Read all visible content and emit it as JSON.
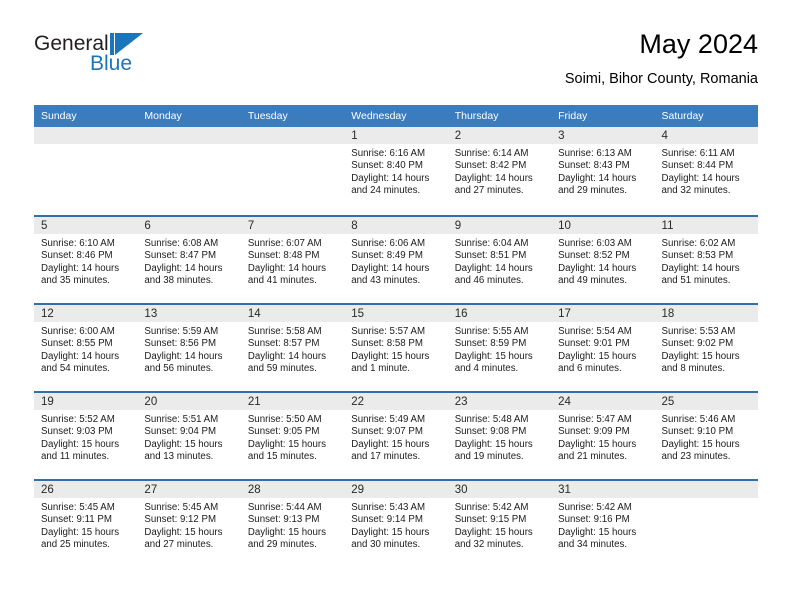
{
  "brand": {
    "name_top": "General",
    "name_bottom": "Blue",
    "mark": "triangle-logo",
    "accent_color": "#1b75bb"
  },
  "header": {
    "title": "May 2024",
    "subtitle": "Soimi, Bihor County, Romania"
  },
  "theme": {
    "header_blue": "#3b7cbe",
    "row_divider_blue": "#2f6fae",
    "day_band_gray": "#ebebeb"
  },
  "calendar": {
    "weekday_headers": [
      "Sunday",
      "Monday",
      "Tuesday",
      "Wednesday",
      "Thursday",
      "Friday",
      "Saturday"
    ],
    "labels": {
      "sunrise": "Sunrise:",
      "sunset": "Sunset:",
      "daylight": "Daylight:"
    },
    "weeks": [
      [
        {
          "day": "",
          "lines": []
        },
        {
          "day": "",
          "lines": []
        },
        {
          "day": "",
          "lines": []
        },
        {
          "day": "1",
          "lines": [
            "Sunrise: 6:16 AM",
            "Sunset: 8:40 PM",
            "Daylight: 14 hours and 24 minutes."
          ]
        },
        {
          "day": "2",
          "lines": [
            "Sunrise: 6:14 AM",
            "Sunset: 8:42 PM",
            "Daylight: 14 hours and 27 minutes."
          ]
        },
        {
          "day": "3",
          "lines": [
            "Sunrise: 6:13 AM",
            "Sunset: 8:43 PM",
            "Daylight: 14 hours and 29 minutes."
          ]
        },
        {
          "day": "4",
          "lines": [
            "Sunrise: 6:11 AM",
            "Sunset: 8:44 PM",
            "Daylight: 14 hours and 32 minutes."
          ]
        }
      ],
      [
        {
          "day": "5",
          "lines": [
            "Sunrise: 6:10 AM",
            "Sunset: 8:46 PM",
            "Daylight: 14 hours and 35 minutes."
          ]
        },
        {
          "day": "6",
          "lines": [
            "Sunrise: 6:08 AM",
            "Sunset: 8:47 PM",
            "Daylight: 14 hours and 38 minutes."
          ]
        },
        {
          "day": "7",
          "lines": [
            "Sunrise: 6:07 AM",
            "Sunset: 8:48 PM",
            "Daylight: 14 hours and 41 minutes."
          ]
        },
        {
          "day": "8",
          "lines": [
            "Sunrise: 6:06 AM",
            "Sunset: 8:49 PM",
            "Daylight: 14 hours and 43 minutes."
          ]
        },
        {
          "day": "9",
          "lines": [
            "Sunrise: 6:04 AM",
            "Sunset: 8:51 PM",
            "Daylight: 14 hours and 46 minutes."
          ]
        },
        {
          "day": "10",
          "lines": [
            "Sunrise: 6:03 AM",
            "Sunset: 8:52 PM",
            "Daylight: 14 hours and 49 minutes."
          ]
        },
        {
          "day": "11",
          "lines": [
            "Sunrise: 6:02 AM",
            "Sunset: 8:53 PM",
            "Daylight: 14 hours and 51 minutes."
          ]
        }
      ],
      [
        {
          "day": "12",
          "lines": [
            "Sunrise: 6:00 AM",
            "Sunset: 8:55 PM",
            "Daylight: 14 hours and 54 minutes."
          ]
        },
        {
          "day": "13",
          "lines": [
            "Sunrise: 5:59 AM",
            "Sunset: 8:56 PM",
            "Daylight: 14 hours and 56 minutes."
          ]
        },
        {
          "day": "14",
          "lines": [
            "Sunrise: 5:58 AM",
            "Sunset: 8:57 PM",
            "Daylight: 14 hours and 59 minutes."
          ]
        },
        {
          "day": "15",
          "lines": [
            "Sunrise: 5:57 AM",
            "Sunset: 8:58 PM",
            "Daylight: 15 hours and 1 minute."
          ]
        },
        {
          "day": "16",
          "lines": [
            "Sunrise: 5:55 AM",
            "Sunset: 8:59 PM",
            "Daylight: 15 hours and 4 minutes."
          ]
        },
        {
          "day": "17",
          "lines": [
            "Sunrise: 5:54 AM",
            "Sunset: 9:01 PM",
            "Daylight: 15 hours and 6 minutes."
          ]
        },
        {
          "day": "18",
          "lines": [
            "Sunrise: 5:53 AM",
            "Sunset: 9:02 PM",
            "Daylight: 15 hours and 8 minutes."
          ]
        }
      ],
      [
        {
          "day": "19",
          "lines": [
            "Sunrise: 5:52 AM",
            "Sunset: 9:03 PM",
            "Daylight: 15 hours and 11 minutes."
          ]
        },
        {
          "day": "20",
          "lines": [
            "Sunrise: 5:51 AM",
            "Sunset: 9:04 PM",
            "Daylight: 15 hours and 13 minutes."
          ]
        },
        {
          "day": "21",
          "lines": [
            "Sunrise: 5:50 AM",
            "Sunset: 9:05 PM",
            "Daylight: 15 hours and 15 minutes."
          ]
        },
        {
          "day": "22",
          "lines": [
            "Sunrise: 5:49 AM",
            "Sunset: 9:07 PM",
            "Daylight: 15 hours and 17 minutes."
          ]
        },
        {
          "day": "23",
          "lines": [
            "Sunrise: 5:48 AM",
            "Sunset: 9:08 PM",
            "Daylight: 15 hours and 19 minutes."
          ]
        },
        {
          "day": "24",
          "lines": [
            "Sunrise: 5:47 AM",
            "Sunset: 9:09 PM",
            "Daylight: 15 hours and 21 minutes."
          ]
        },
        {
          "day": "25",
          "lines": [
            "Sunrise: 5:46 AM",
            "Sunset: 9:10 PM",
            "Daylight: 15 hours and 23 minutes."
          ]
        }
      ],
      [
        {
          "day": "26",
          "lines": [
            "Sunrise: 5:45 AM",
            "Sunset: 9:11 PM",
            "Daylight: 15 hours and 25 minutes."
          ]
        },
        {
          "day": "27",
          "lines": [
            "Sunrise: 5:45 AM",
            "Sunset: 9:12 PM",
            "Daylight: 15 hours and 27 minutes."
          ]
        },
        {
          "day": "28",
          "lines": [
            "Sunrise: 5:44 AM",
            "Sunset: 9:13 PM",
            "Daylight: 15 hours and 29 minutes."
          ]
        },
        {
          "day": "29",
          "lines": [
            "Sunrise: 5:43 AM",
            "Sunset: 9:14 PM",
            "Daylight: 15 hours and 30 minutes."
          ]
        },
        {
          "day": "30",
          "lines": [
            "Sunrise: 5:42 AM",
            "Sunset: 9:15 PM",
            "Daylight: 15 hours and 32 minutes."
          ]
        },
        {
          "day": "31",
          "lines": [
            "Sunrise: 5:42 AM",
            "Sunset: 9:16 PM",
            "Daylight: 15 hours and 34 minutes."
          ]
        },
        {
          "day": "",
          "lines": []
        }
      ]
    ]
  }
}
